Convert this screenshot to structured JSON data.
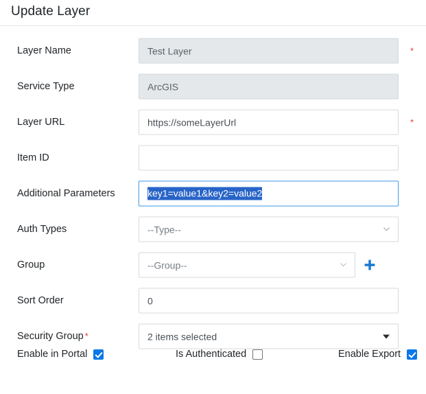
{
  "dialog": {
    "title": "Update Layer"
  },
  "fields": [
    {
      "label": "Layer Name",
      "value": "Test Layer",
      "type": "text",
      "disabled": true,
      "required_marker": "*"
    },
    {
      "label": "Service Type",
      "value": "ArcGIS",
      "type": "text",
      "disabled": true,
      "required_marker": ""
    },
    {
      "label": "Layer URL",
      "value": "https://someLayerUrl",
      "type": "text",
      "disabled": false,
      "required_marker": "*"
    },
    {
      "label": "Item ID",
      "value": "",
      "type": "text",
      "disabled": false,
      "required_marker": ""
    },
    {
      "label": "Additional Parameters",
      "value": "key1=value1&key2=value2",
      "type": "text-selected",
      "disabled": false,
      "required_marker": ""
    },
    {
      "label": "Auth Types",
      "value": "--Type--",
      "type": "select",
      "disabled": false,
      "required_marker": ""
    },
    {
      "label": "Group",
      "value": "--Group--",
      "type": "select-narrow",
      "disabled": false,
      "required_marker": "",
      "add_button": "plus-icon"
    },
    {
      "label": "Sort Order",
      "value": "0",
      "type": "text",
      "disabled": false,
      "required_marker": ""
    },
    {
      "label": "Security Group",
      "label_required": "*",
      "value": "2 items selected",
      "type": "multiselect",
      "disabled": false,
      "required_marker": ""
    }
  ],
  "checkboxes": [
    {
      "label": "Enable in Portal",
      "checked": true
    },
    {
      "label": "Is Authenticated",
      "checked": false
    },
    {
      "label": "Enable Export",
      "checked": true
    }
  ],
  "colors": {
    "accent_blue": "#0a78e8",
    "selection_blue": "#2864c8",
    "required_red": "#e8413c",
    "disabled_bg": "#e5e8ea",
    "border_grey": "#d6d9dc",
    "focus_border": "#5da7e8"
  }
}
